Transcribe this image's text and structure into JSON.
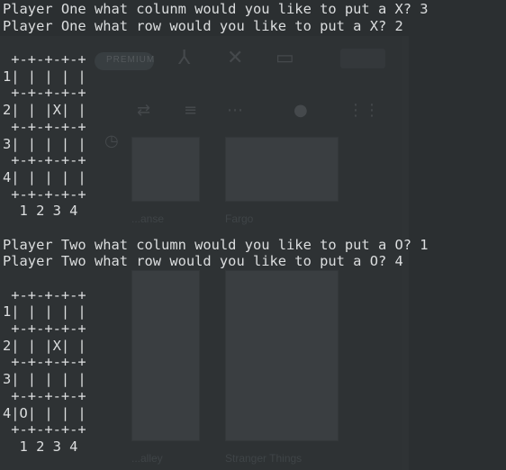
{
  "terminal": {
    "lines": [
      "Player One what colunm would you like to put a X? 3",
      "Player One what row would you like to put a X? 2",
      "",
      " +-+-+-+-+",
      "1| | | | |",
      " +-+-+-+-+",
      "2| | |X| |",
      " +-+-+-+-+",
      "3| | | | |",
      " +-+-+-+-+",
      "4| | | | |",
      " +-+-+-+-+",
      "  1 2 3 4",
      "",
      "Player Two what column would you like to put a O? 1",
      "Player Two what row would you like to put a O? 4",
      "",
      " +-+-+-+-+",
      "1| | | | |",
      " +-+-+-+-+",
      "2| | |X| |",
      " +-+-+-+-+",
      "3| | | | |",
      " +-+-+-+-+",
      "4|O| | | |",
      " +-+-+-+-+",
      "  1 2 3 4"
    ]
  },
  "background_app": {
    "pill_label": "PREMIUM",
    "tiles": [
      {
        "title": "...anse"
      },
      {
        "title": "Fargo"
      },
      {
        "title": "...alley"
      },
      {
        "title": "Stranger Things"
      }
    ]
  },
  "colors": {
    "background": "#2b2f31",
    "text": "#dcdedf"
  }
}
